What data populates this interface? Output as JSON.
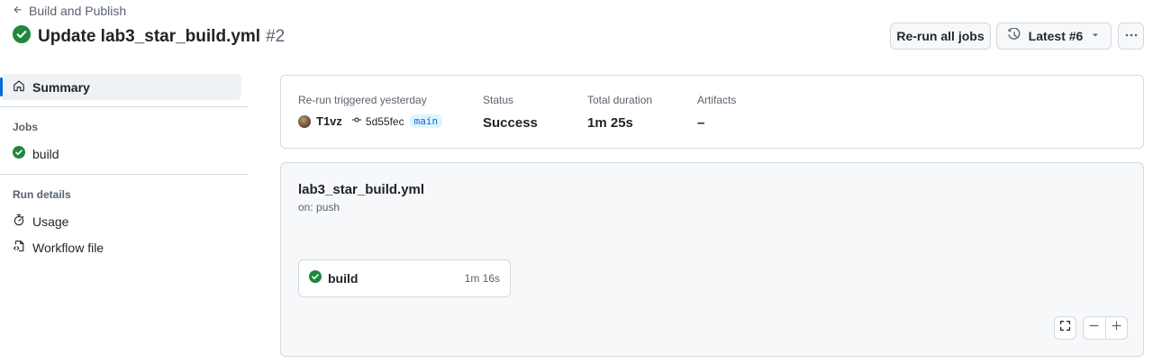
{
  "header": {
    "back_label": "Build and Publish",
    "title": "Update lab3_star_build.yml",
    "run_number": "#2",
    "rerun_label": "Re-run all jobs",
    "latest_label": "Latest #6"
  },
  "sidebar": {
    "summary_label": "Summary",
    "jobs_heading": "Jobs",
    "jobs": [
      {
        "label": "build",
        "status": "success"
      }
    ],
    "run_details_heading": "Run details",
    "usage_label": "Usage",
    "workflow_file_label": "Workflow file"
  },
  "summary": {
    "trigger_label": "Re-run triggered yesterday",
    "user": "T1vz",
    "commit": "5d55fec",
    "branch": "main",
    "status_label": "Status",
    "status_value": "Success",
    "duration_label": "Total duration",
    "duration_value": "1m 25s",
    "artifacts_label": "Artifacts",
    "artifacts_value": "–"
  },
  "graph": {
    "workflow_name": "lab3_star_build.yml",
    "trigger": "on: push",
    "job_name": "build",
    "job_duration": "1m 16s"
  },
  "colors": {
    "success": "#1f883d",
    "accent": "#0969da"
  },
  "icons": {
    "back": "arrow-left-icon",
    "status": "check-circle-fill-icon",
    "latest": "history-icon",
    "more": "kebab-horizontal-icon",
    "summary": "home-icon",
    "usage": "stopwatch-icon",
    "workflow_file": "file-code-icon",
    "commit": "git-commit-icon",
    "fullscreen": "screen-full-icon",
    "zoom_out": "dash-icon",
    "zoom_in": "plus-icon"
  }
}
